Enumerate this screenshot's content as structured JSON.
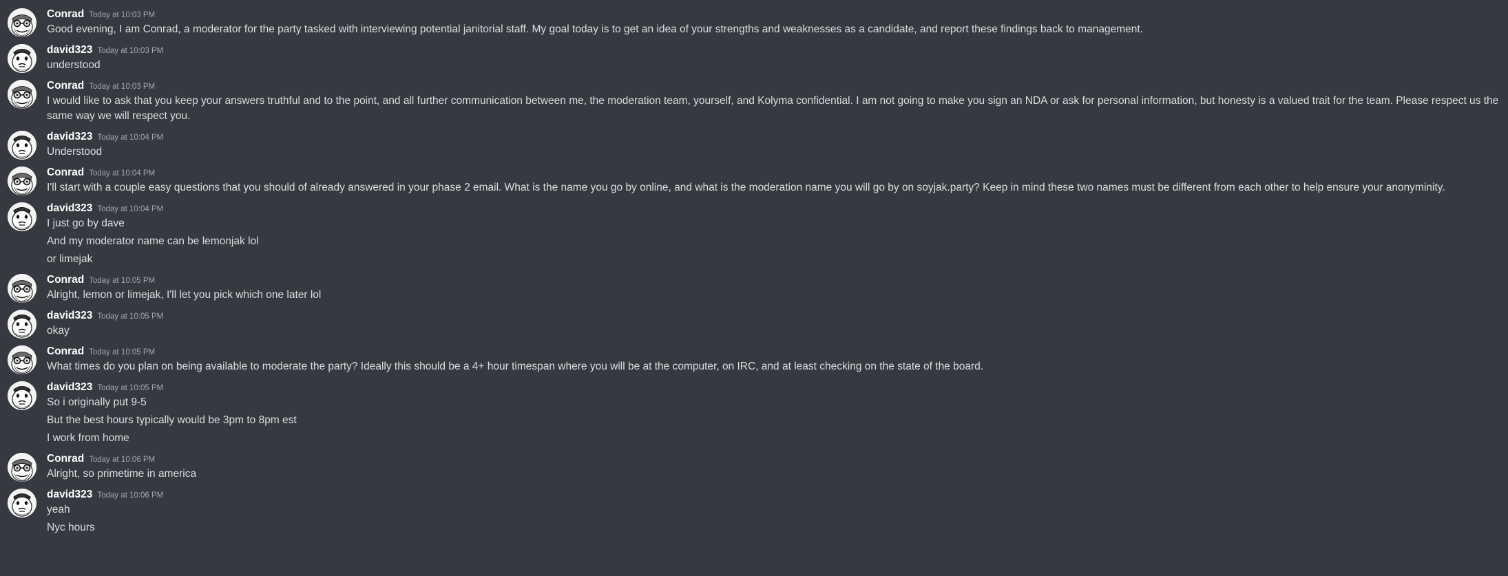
{
  "messages": [
    {
      "author": "Conrad",
      "avatar": "conrad-avatar",
      "timestamp": "Today at 10:03 PM",
      "lines": [
        "Good evening, I am Conrad, a moderator for the party tasked with interviewing potential janitorial staff. My goal today is to get an idea of your strengths and weaknesses as a candidate, and report these findings back to management."
      ]
    },
    {
      "author": "david323",
      "avatar": "david-avatar",
      "timestamp": "Today at 10:03 PM",
      "lines": [
        "understood"
      ]
    },
    {
      "author": "Conrad",
      "avatar": "conrad-avatar",
      "timestamp": "Today at 10:03 PM",
      "lines": [
        "I would like to ask that you keep your answers truthful and to the point, and all further communication between me, the moderation team, yourself, and Kolyma confidential. I am not going to make you sign an NDA or ask for personal information, but honesty is a valued trait for the team. Please respect us the same way we will respect you."
      ]
    },
    {
      "author": "david323",
      "avatar": "david-avatar",
      "timestamp": "Today at 10:04 PM",
      "lines": [
        "Understood"
      ]
    },
    {
      "author": "Conrad",
      "avatar": "conrad-avatar",
      "timestamp": "Today at 10:04 PM",
      "lines": [
        "I'll start with a couple easy questions that you should of already answered in your phase 2 email. What is the name you go by online, and what is the moderation name you will go by on soyjak.party? Keep in mind these two names must be different from each other to help ensure your anonyminity."
      ]
    },
    {
      "author": "david323",
      "avatar": "david-avatar",
      "timestamp": "Today at 10:04 PM",
      "lines": [
        "I just go by dave",
        "And my moderator name can be lemonjak lol",
        "or limejak"
      ]
    },
    {
      "author": "Conrad",
      "avatar": "conrad-avatar",
      "timestamp": "Today at 10:05 PM",
      "lines": [
        "Alright, lemon or limejak, I'll let you pick which one later lol"
      ]
    },
    {
      "author": "david323",
      "avatar": "david-avatar",
      "timestamp": "Today at 10:05 PM",
      "lines": [
        "okay"
      ]
    },
    {
      "author": "Conrad",
      "avatar": "conrad-avatar",
      "timestamp": "Today at 10:05 PM",
      "lines": [
        "What times do you plan on being available to moderate the party? Ideally this should be a 4+ hour timespan where you will be at the computer, on IRC, and at least checking on the state of the board."
      ]
    },
    {
      "author": "david323",
      "avatar": "david-avatar",
      "timestamp": "Today at 10:05 PM",
      "lines": [
        "So i originally put 9-5",
        "But the best hours typically would be 3pm to 8pm est",
        "I work from home"
      ]
    },
    {
      "author": "Conrad",
      "avatar": "conrad-avatar",
      "timestamp": "Today at 10:06 PM",
      "lines": [
        "Alright, so primetime in america"
      ]
    },
    {
      "author": "david323",
      "avatar": "david-avatar",
      "timestamp": "Today at 10:06 PM",
      "lines": [
        "yeah",
        "Nyc hours"
      ]
    }
  ]
}
